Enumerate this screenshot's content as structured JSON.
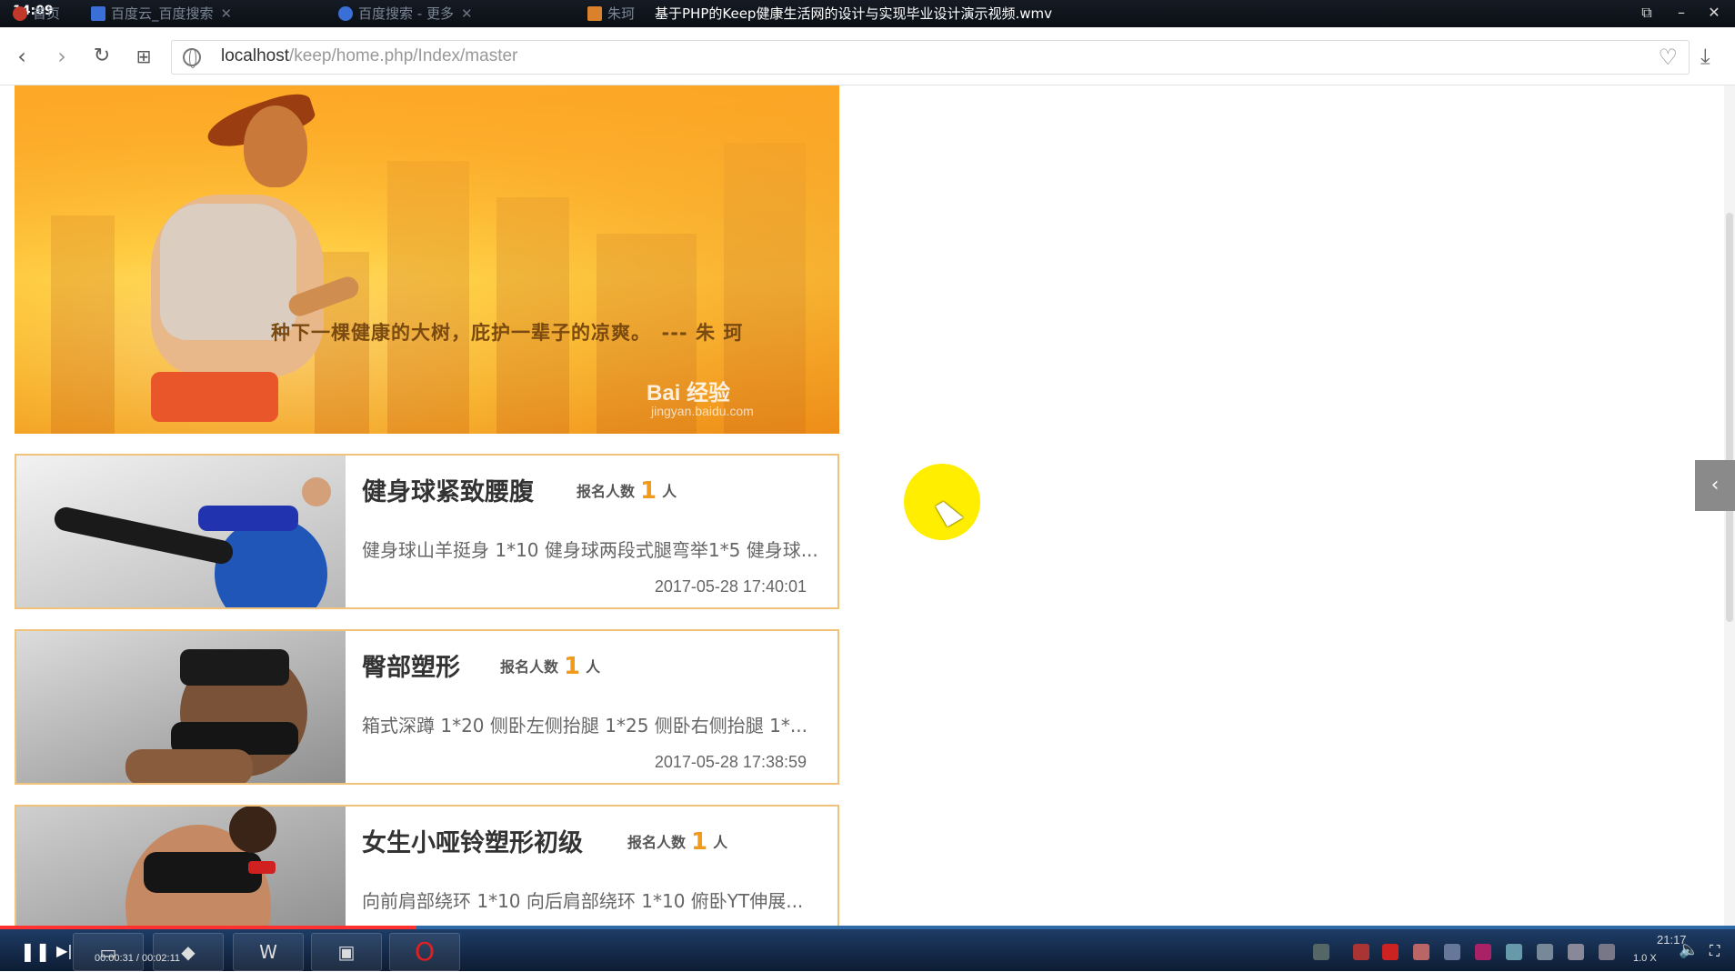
{
  "player": {
    "clock": "14:09",
    "video_title": "基于PHP的Keep健康生活网的设计与实现毕业设计演示视频.wmv",
    "time": "00:00:31 / 00:02:11",
    "progress_fraction": 0.24,
    "speed": "1.0 X",
    "system_clock": "21:17"
  },
  "browser": {
    "tabs": [
      {
        "label": "首页",
        "color": "#c0392b"
      },
      {
        "label": "百度云_百度搜索",
        "color": "#3b6fd8"
      },
      {
        "label": "百度搜索 - 更多",
        "color": "#3b6fd8"
      },
      {
        "label": "朱珂",
        "color": "#d9822b"
      }
    ],
    "url_host": "localhost",
    "url_path": "/keep/home.php/Index/master"
  },
  "banner": {
    "quote": "种下一棵健康的大树，庇护一辈子的凉爽。　--- 朱 珂",
    "watermark": "Bai 经验",
    "watermark_sub": "jingyan.baidu.com"
  },
  "signup_label": "报名人数",
  "signup_unit": "人",
  "courses": [
    {
      "title": "健身球紧致腰腹",
      "count": "1",
      "desc": "健身球山羊挺身 1*10 健身球两段式腿弯举1*5 健身球...",
      "date": "2017-05-28 17:40:01"
    },
    {
      "title": "臀部塑形",
      "count": "1",
      "desc": "箱式深蹲 1*20 侧卧左侧抬腿 1*25 侧卧右侧抬腿 1*...",
      "date": "2017-05-28 17:38:59"
    },
    {
      "title": "女生小哑铃塑形初级",
      "count": "1",
      "desc": "向前肩部绕环 1*10 向后肩部绕环 1*10 俯卧YT伸展...",
      "date": ""
    }
  ]
}
